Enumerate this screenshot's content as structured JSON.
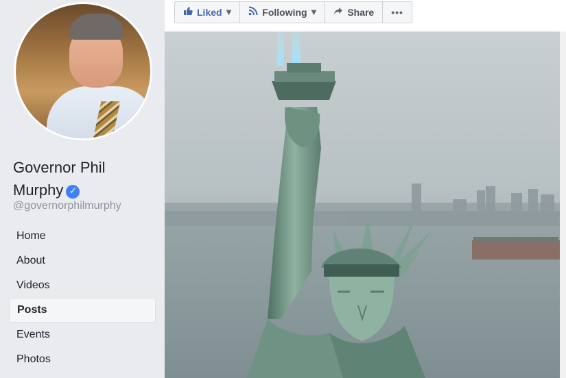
{
  "sidebar": {
    "page_name": "Governor Phil Murphy",
    "handle": "@governorphilmurphy",
    "verified_icon": "✓",
    "nav": [
      {
        "label": "Home",
        "active": false
      },
      {
        "label": "About",
        "active": false
      },
      {
        "label": "Videos",
        "active": false
      },
      {
        "label": "Posts",
        "active": true
      },
      {
        "label": "Events",
        "active": false
      },
      {
        "label": "Photos",
        "active": false
      }
    ]
  },
  "actions": {
    "liked": {
      "label": "Liked",
      "icon": "thumbs-up-icon"
    },
    "following": {
      "label": "Following",
      "icon": "rss-icon"
    },
    "share": {
      "label": "Share",
      "icon": "share-arrow-icon"
    },
    "more": {
      "label": "•••",
      "icon": "more-icon"
    }
  },
  "colors": {
    "accent": "#4267b2",
    "verified": "#4080ff",
    "background": "#e9ebee"
  }
}
